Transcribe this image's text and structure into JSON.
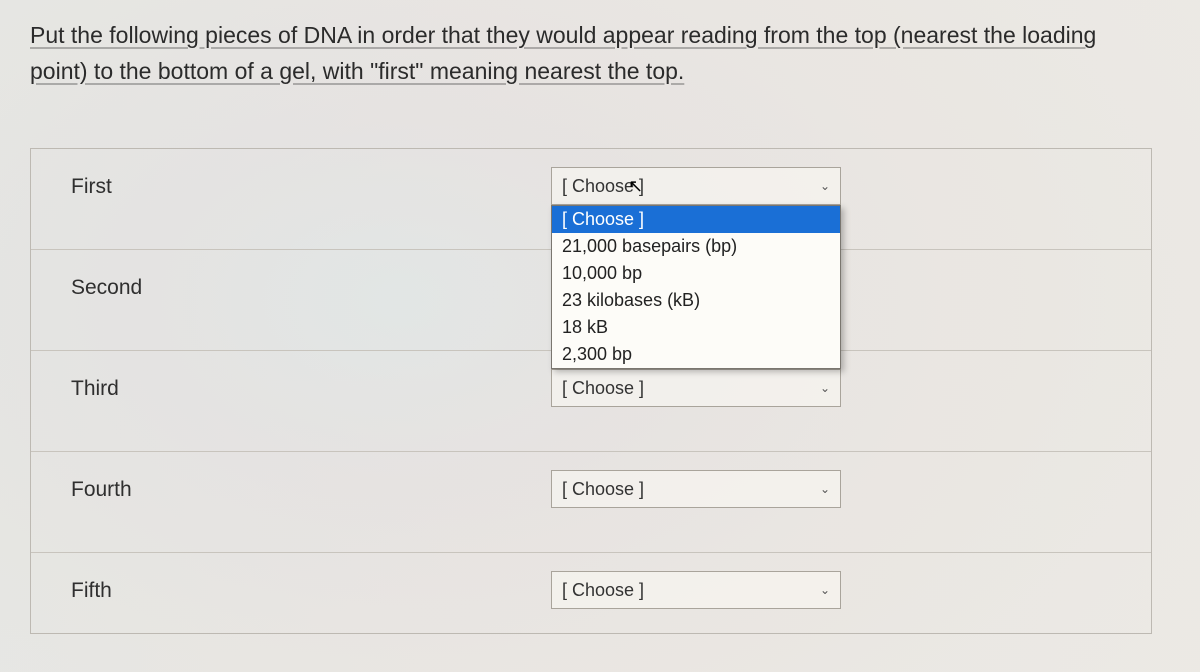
{
  "question": "Put the following pieces of DNA in order that they would appear reading from the top (nearest the loading point) to the bottom of a gel, with \"first\" meaning nearest the top.",
  "rows": [
    {
      "label": "First",
      "selected": "[ Choose ]"
    },
    {
      "label": "Second",
      "selected": ""
    },
    {
      "label": "Third",
      "selected": "[ Choose ]"
    },
    {
      "label": "Fourth",
      "selected": "[ Choose ]"
    },
    {
      "label": "Fifth",
      "selected": "[ Choose ]"
    }
  ],
  "dropdown": {
    "highlighted": "[ Choose ]",
    "options": [
      "[ Choose ]",
      "21,000 basepairs (bp)",
      "10,000 bp",
      "23 kilobases (kB)",
      "18 kB",
      "2,300 bp"
    ]
  }
}
